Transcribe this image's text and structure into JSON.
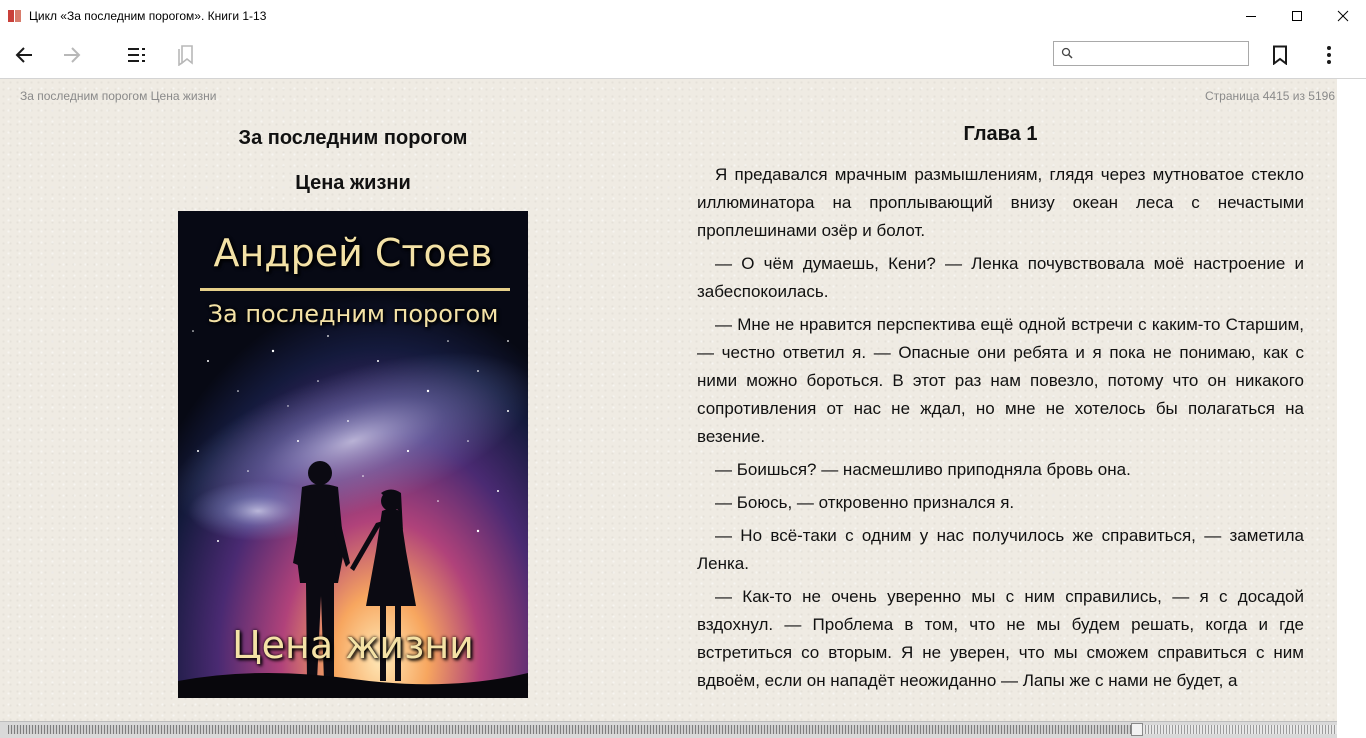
{
  "window": {
    "title": "Цикл «За последним порогом». Книги 1-13"
  },
  "toolbar": {
    "search": {
      "value": "",
      "placeholder": ""
    }
  },
  "reader": {
    "running_head": "За последним порогом Цена жизни",
    "page_counter": "Страница 4415 из 5196",
    "progress": {
      "current_page": 4415,
      "total_pages": 5196
    }
  },
  "left_page": {
    "title": "За последним порогом",
    "subtitle": "Цена жизни",
    "cover": {
      "author": "Андрей Стоев",
      "series": "За последним порогом",
      "book": "Цена жизни"
    }
  },
  "right_page": {
    "chapter": "Глава 1",
    "paragraphs": [
      "Я предавался мрачным размышлениям, глядя через мутноватое стекло иллюминатора на проплывающий внизу океан леса с нечасты­ми проплешинами озёр и болот.",
      "— О чём думаешь, Кени? — Ленка почувствовала моё настроение и забеспокоилась.",
      "— Мне не нравится перспектива ещё одной встречи с каким-то Стар­шим, — честно ответил я. — Опасные они ребята и я пока не понимаю, как с ними можно бороться. В этот раз нам повезло, потому что он ни­какого сопротивления от нас не ждал, но мне не хотелось бы полагать­ся на везение.",
      "— Боишься? — насмешливо приподняла бровь она.",
      "— Боюсь, — откровенно признался я.",
      "— Но всё-таки с одним у нас получилось же справиться, — заметила Ленка.",
      "— Как-то не очень уверенно мы с ним справились, — я с досадой вздохнул. — Проблема в том, что не мы будем решать, когда и где встретиться со вторым. Я не уверен, что мы сможем справиться с ним вдвоём, если он нападёт неожиданно — Лапы же с нами не будет, а"
    ]
  },
  "colors": {
    "page_background": "#efebe3",
    "text": "#111111",
    "muted_text": "#8a8a8a",
    "cover_lettering": "#f4e2a6"
  },
  "icons": {
    "back": "arrow-left-icon",
    "forward": "arrow-right-icon",
    "contents": "table-of-contents-icon",
    "bookmarks": "bookmarks-icon",
    "search": "search-icon",
    "bookmark": "bookmark-icon",
    "more": "more-vertical-icon",
    "minimize": "minimize-icon",
    "maximize": "maximize-icon",
    "close": "close-icon"
  }
}
